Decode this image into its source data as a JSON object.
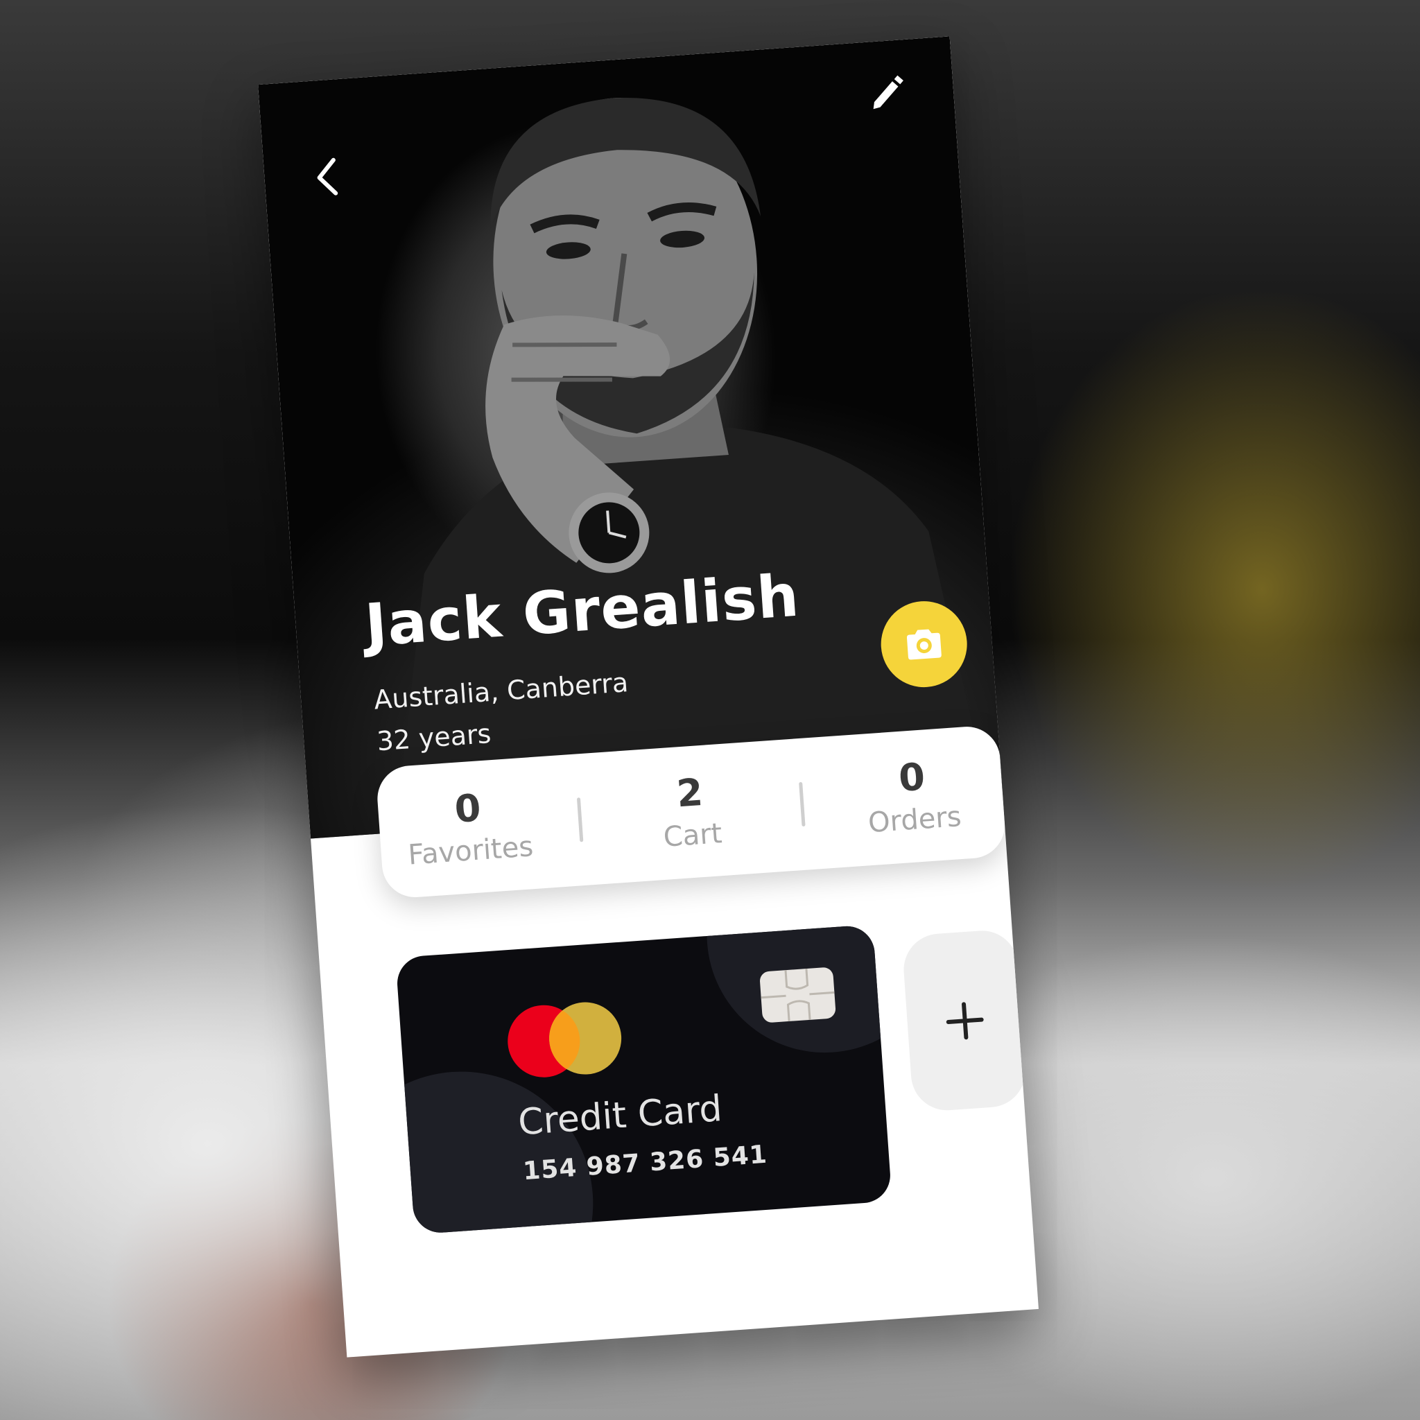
{
  "profile": {
    "name": "Jack Grealish",
    "location": "Australia, Canberra",
    "age": "32 years"
  },
  "stats": [
    {
      "value": "0",
      "label": "Favorites"
    },
    {
      "value": "2",
      "label": "Cart"
    },
    {
      "value": "0",
      "label": "Orders"
    }
  ],
  "card": {
    "title": "Credit Card",
    "number": "154 987 326 541",
    "brand_colors": {
      "red": "#eb001b",
      "yellow": "#f2be3a",
      "overlap": "#f79e1b"
    }
  },
  "icons": {
    "back": "chevron-left-icon",
    "edit": "pencil-icon",
    "camera": "camera-icon",
    "add": "plus-icon",
    "chip": "card-chip-icon",
    "brand": "mastercard-logo"
  },
  "colors": {
    "accent": "#f5d43a",
    "hero_bg": "#050505",
    "card_bg": "#0c0c10",
    "muted_text": "#a7a7a7",
    "stat_text": "#3a3a3a"
  }
}
